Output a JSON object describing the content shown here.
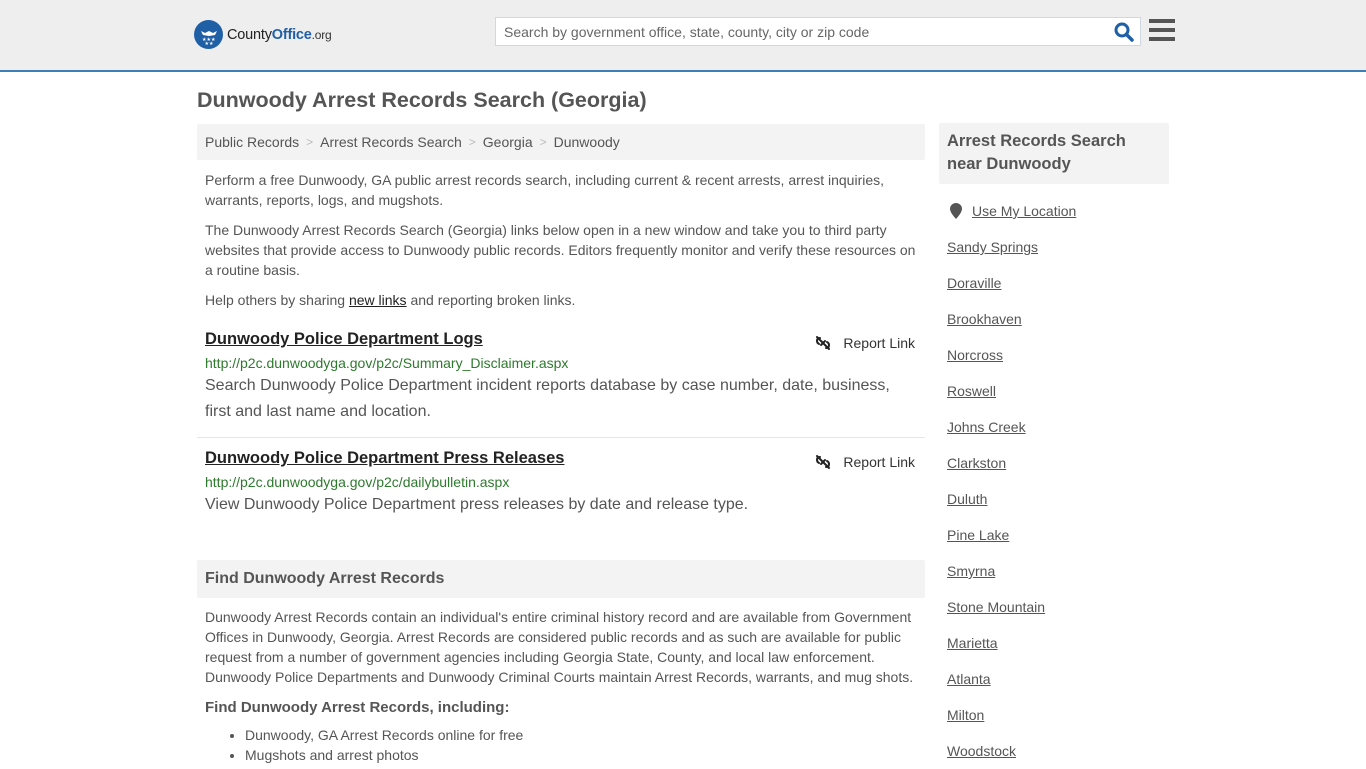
{
  "header": {
    "logo": {
      "text_main": "County",
      "text_accent": "Office",
      "text_suffix": ".org",
      "icon": "eagle-stars-badge-icon"
    },
    "search": {
      "placeholder": "Search by government office, state, county, city or zip code",
      "value": "",
      "icon": "search-icon"
    },
    "menu_icon": "hamburger-menu-icon",
    "colors": {
      "accent": "#3b7fb5",
      "brand": "#1f5fa6",
      "background": "#eeeeee"
    }
  },
  "page": {
    "title": "Dunwoody Arrest Records Search (Georgia)",
    "breadcrumb": [
      {
        "label": "Public Records"
      },
      {
        "label": "Arrest Records Search"
      },
      {
        "label": "Georgia"
      },
      {
        "label": "Dunwoody"
      }
    ],
    "breadcrumb_separator": ">",
    "intro": {
      "p1": "Perform a free Dunwoody, GA public arrest records search, including current & recent arrests, arrest inquiries, warrants, reports, logs, and mugshots.",
      "p2": "The Dunwoody Arrest Records Search (Georgia) links below open in a new window and take you to third party websites that provide access to Dunwoody public records. Editors frequently monitor and verify these resources on a routine basis.",
      "p3_before": "Help others by sharing ",
      "p3_link": "new links",
      "p3_after": " and reporting broken links."
    },
    "results": [
      {
        "title": "Dunwoody Police Department Logs",
        "url": "http://p2c.dunwoodyga.gov/p2c/Summary_Disclaimer.aspx",
        "description": "Search Dunwoody Police Department incident reports database by case number, date, business, first and last name and location.",
        "report_label": "Report Link"
      },
      {
        "title": "Dunwoody Police Department Press Releases",
        "url": "http://p2c.dunwoodyga.gov/p2c/dailybulletin.aspx",
        "description": "View Dunwoody Police Department press releases by date and release type.",
        "report_label": "Report Link"
      }
    ],
    "find_section": {
      "heading": "Find Dunwoody Arrest Records",
      "body": "Dunwoody Arrest Records contain an individual's entire criminal history record and are available from Government Offices in Dunwoody, Georgia. Arrest Records are considered public records and as such are available for public request from a number of government agencies including Georgia State, County, and local law enforcement. Dunwoody Police Departments and Dunwoody Criminal Courts maintain Arrest Records, warrants, and mug shots.",
      "subheading": "Find Dunwoody Arrest Records, including:",
      "items": [
        "Dunwoody, GA Arrest Records online for free",
        "Mugshots and arrest photos"
      ]
    }
  },
  "sidebar": {
    "heading": "Arrest Records Search near Dunwoody",
    "use_location": "Use My Location",
    "cities": [
      "Sandy Springs",
      "Doraville",
      "Brookhaven",
      "Norcross",
      "Roswell",
      "Johns Creek",
      "Clarkston",
      "Duluth",
      "Pine Lake",
      "Smyrna",
      "Stone Mountain",
      "Marietta",
      "Atlanta",
      "Milton",
      "Woodstock"
    ]
  }
}
